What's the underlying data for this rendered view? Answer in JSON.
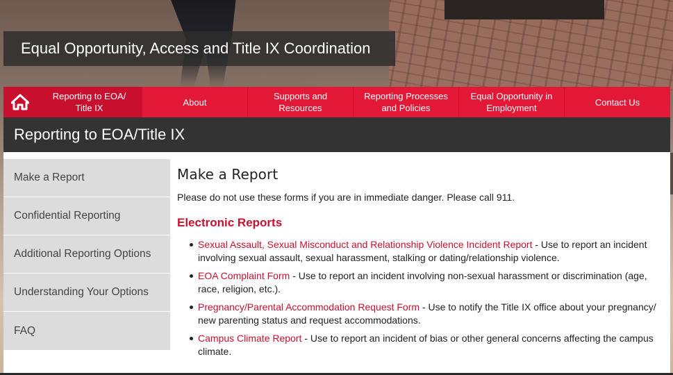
{
  "site": {
    "title": "Equal Opportunity, Access and Title IX Coordination"
  },
  "nav": {
    "home_icon": "home-icon",
    "items": [
      {
        "label": "Reporting to EOA/ Title IX"
      },
      {
        "label": "About"
      },
      {
        "label": "Supports and Resources"
      },
      {
        "label": "Reporting Processes and Policies"
      },
      {
        "label": "Equal Opportunity in Employment"
      },
      {
        "label": "Contact Us"
      }
    ]
  },
  "section": {
    "title": "Reporting to EOA/Title IX"
  },
  "sidebar": {
    "items": [
      {
        "label": "Make a Report"
      },
      {
        "label": "Confidential Reporting"
      },
      {
        "label": "Additional Reporting Options"
      },
      {
        "label": "Understanding Your Options"
      },
      {
        "label": "FAQ"
      }
    ]
  },
  "main": {
    "heading": "Make a Report",
    "intro": "Please do not use these forms if you are in immediate danger. Please call 911.",
    "subheading": "Electronic Reports",
    "reports": [
      {
        "link": "Sexual Assault, Sexual Misconduct and Relationship Violence Incident Report",
        "description": " - Use to report an incident involving sexual assault, sexual harassment, stalking or dating/relationship violence."
      },
      {
        "link": "EOA Complaint Form",
        "description": " - Use to report an incident involving non-sexual harassment or discrimination (age, race, religion, etc.)."
      },
      {
        "link": "Pregnancy/Parental Accommodation Request Form",
        "description": " - Use to notify the Title IX office about your pregnancy/ new parenting status and request accommodations."
      },
      {
        "link": "Campus Climate Report",
        "description": " - Use to report an incident of bias or other general concerns affecting the campus climate."
      }
    ]
  },
  "colors": {
    "brand_red": "#c8102e",
    "nav_red": "#e31837",
    "header_dark": "#333333",
    "sidebar_gray": "#dcdcdc"
  }
}
